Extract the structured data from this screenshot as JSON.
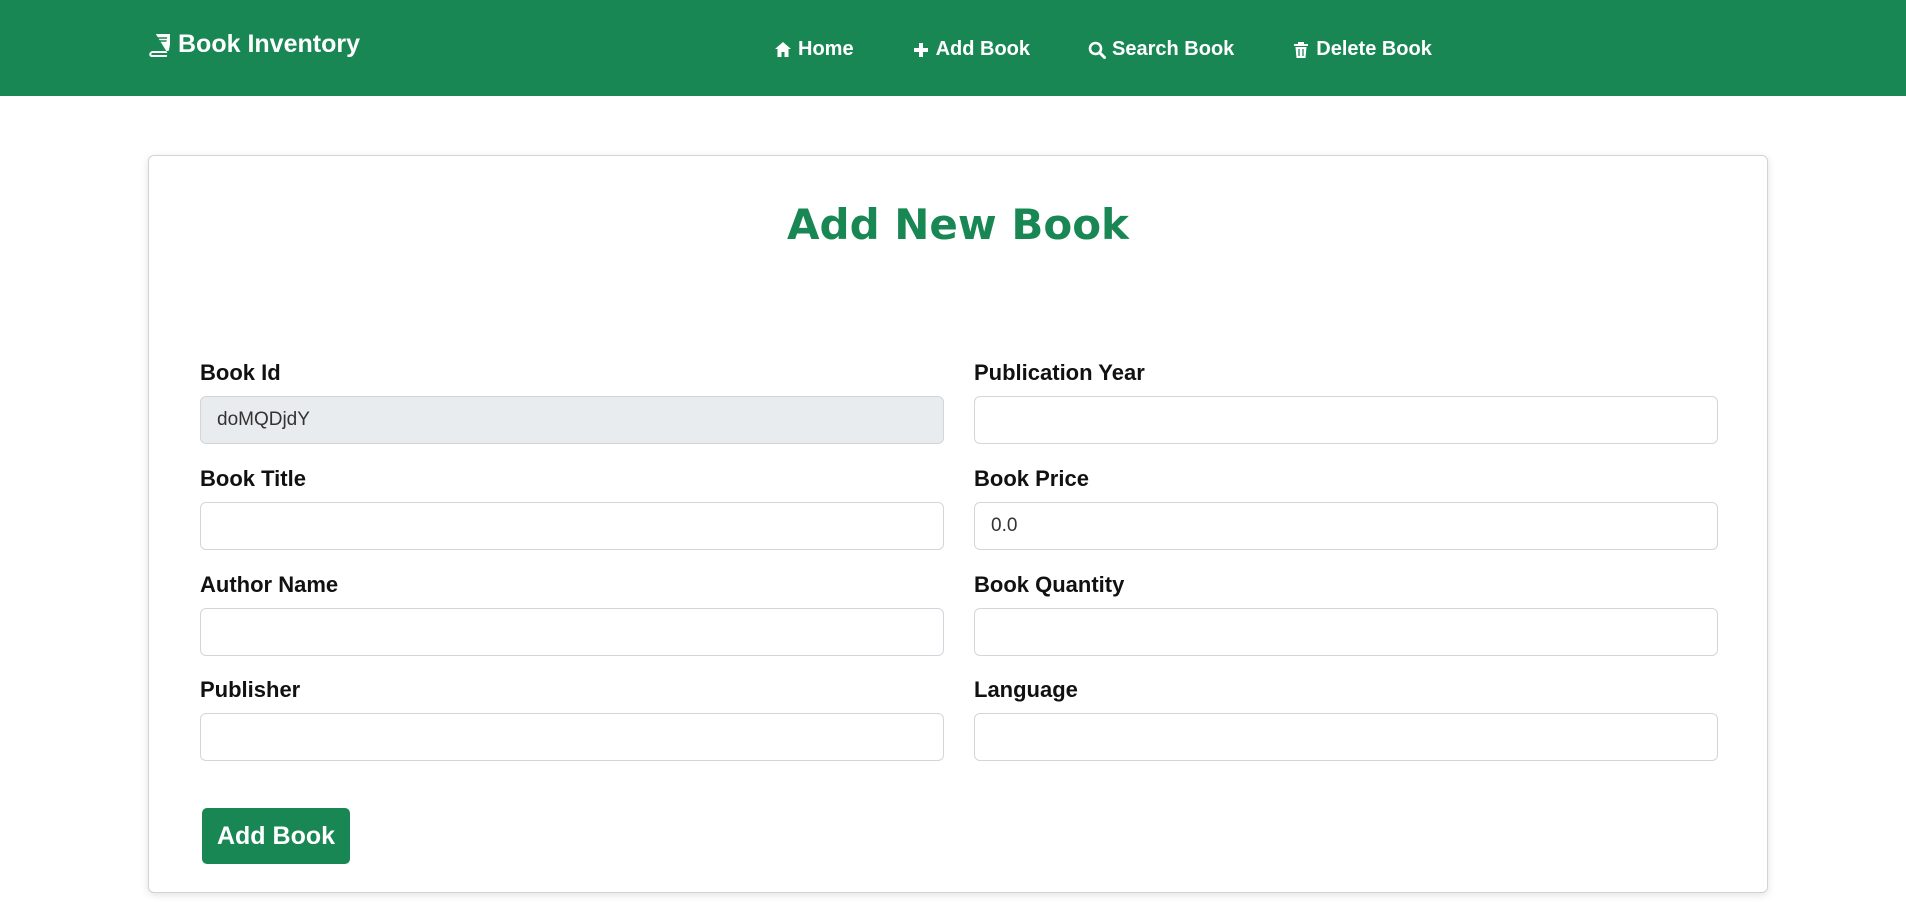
{
  "navbar": {
    "brand": "Book Inventory",
    "brand_icon": "book-icon",
    "color": "#198754",
    "links": [
      {
        "label": "Home",
        "icon": "home-icon"
      },
      {
        "label": "Add Book",
        "icon": "plus-icon"
      },
      {
        "label": "Search Book",
        "icon": "search-icon"
      },
      {
        "label": "Delete Book",
        "icon": "trash-icon"
      }
    ]
  },
  "form": {
    "title": "Add New Book",
    "fields": {
      "book_id": {
        "label": "Book Id",
        "value": "doMQDjdY"
      },
      "book_title": {
        "label": "Book Title",
        "value": ""
      },
      "author_name": {
        "label": "Author Name",
        "value": ""
      },
      "publisher": {
        "label": "Publisher",
        "value": ""
      },
      "publication_year": {
        "label": "Publication Year",
        "value": ""
      },
      "book_price": {
        "label": "Book Price",
        "value": "0.0"
      },
      "book_quantity": {
        "label": "Book Quantity",
        "value": ""
      },
      "language": {
        "label": "Language",
        "value": ""
      }
    },
    "submit_label": "Add Book"
  }
}
